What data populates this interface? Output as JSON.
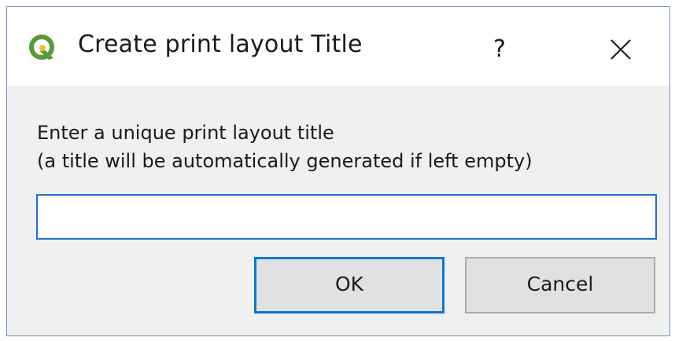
{
  "dialog": {
    "title": "Create print layout Title",
    "help_label": "?",
    "close_icon": "close-icon",
    "app_icon": "qgis-logo-icon"
  },
  "prompt": {
    "line1": "Enter a unique print layout title",
    "line2": "(a title will be automatically generated if left empty)"
  },
  "input": {
    "value": "",
    "placeholder": ""
  },
  "buttons": {
    "ok_label": "OK",
    "cancel_label": "Cancel"
  },
  "colors": {
    "accent": "#0a78d7",
    "logo_green": "#5b9a3b",
    "logo_yellow": "#f2c12e"
  }
}
